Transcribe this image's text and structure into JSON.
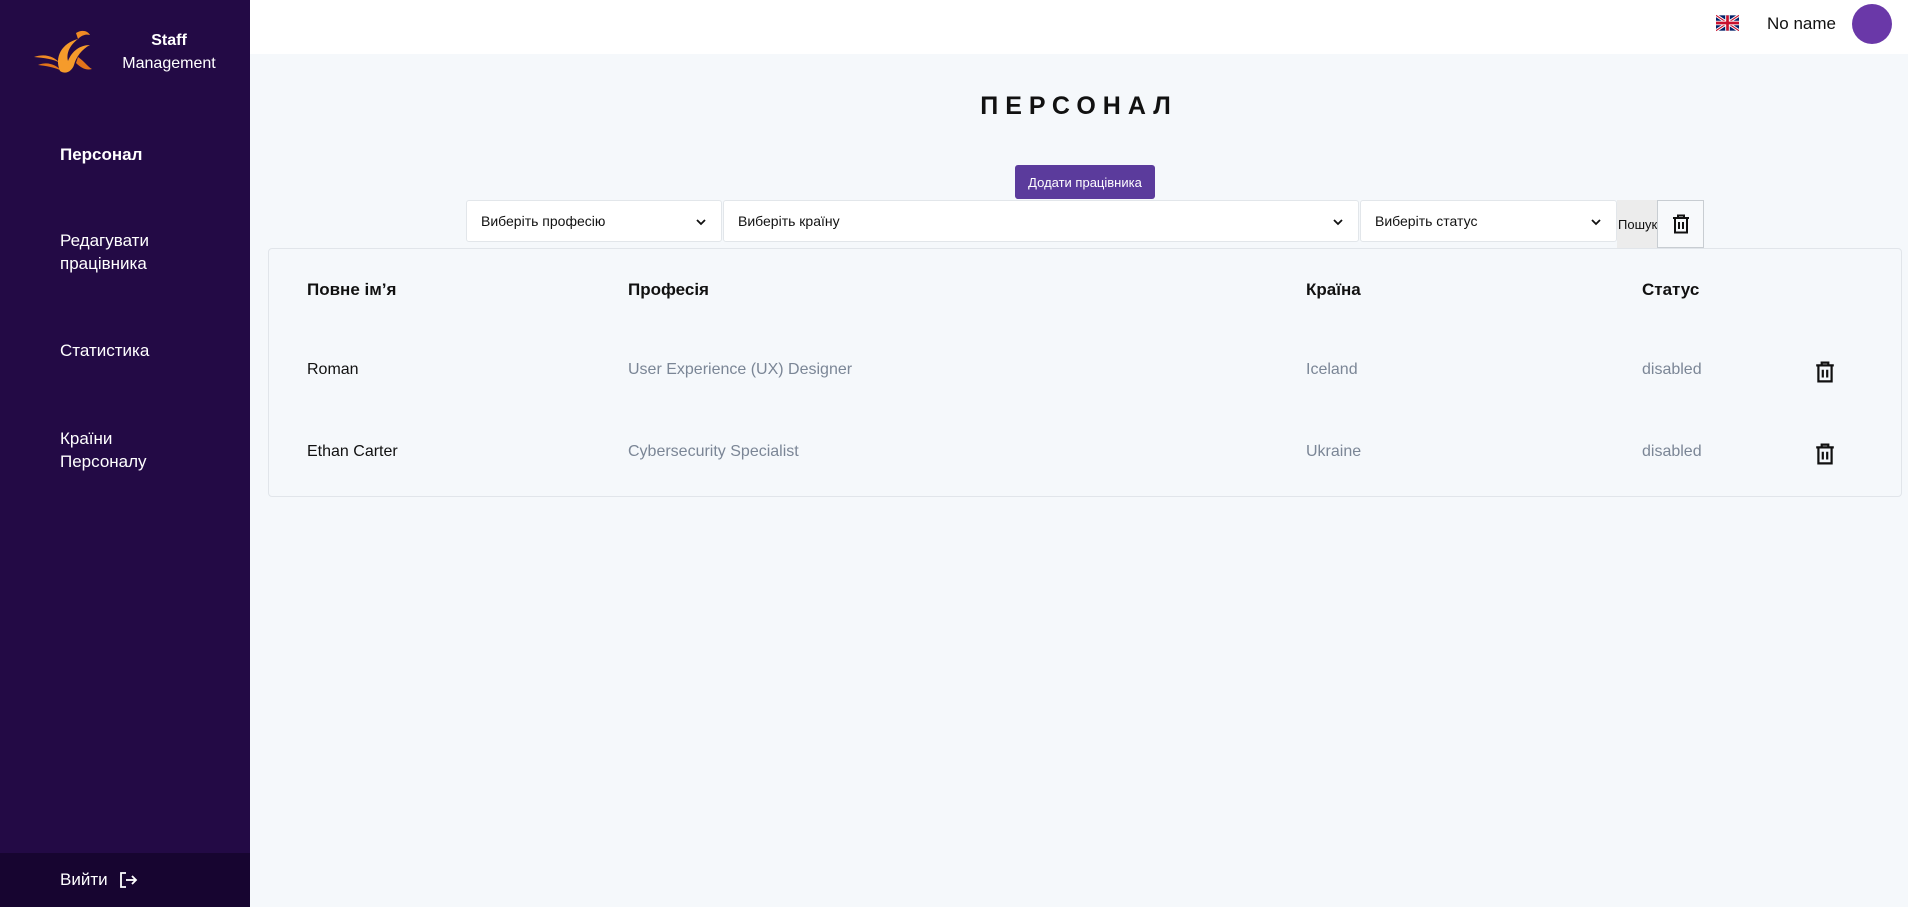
{
  "brand": {
    "line1": "Staff",
    "line2": "Management"
  },
  "sidebar": {
    "items": [
      {
        "label": "Персонал"
      },
      {
        "label": "Редагувати працівника"
      },
      {
        "label": "Статистика"
      },
      {
        "label": "Країни Персоналу"
      }
    ],
    "logout_label": "Вийти"
  },
  "header": {
    "username": "No name",
    "language_icon": "uk-flag-icon"
  },
  "main": {
    "title": "ПЕРСОНАЛ",
    "add_button": "Додати працівника",
    "filters": {
      "profession": "Виберіть професію",
      "country": "Виберіть країну",
      "status": "Виберіть статус",
      "search": "Пошук"
    },
    "table": {
      "columns": [
        "Повне ім’я",
        "Професія",
        "Країна",
        "Статус"
      ],
      "rows": [
        {
          "name": "Roman",
          "profession": "User Experience (UX) Designer",
          "country": "Iceland",
          "status": "disabled"
        },
        {
          "name": "Ethan Carter",
          "profession": "Cybersecurity Specialist",
          "country": "Ukraine",
          "status": "disabled"
        }
      ]
    }
  },
  "colors": {
    "sidebar": "#230a45",
    "accent": "#5b3b9c",
    "avatar": "#6a38a8",
    "logo": "#f08a24"
  }
}
